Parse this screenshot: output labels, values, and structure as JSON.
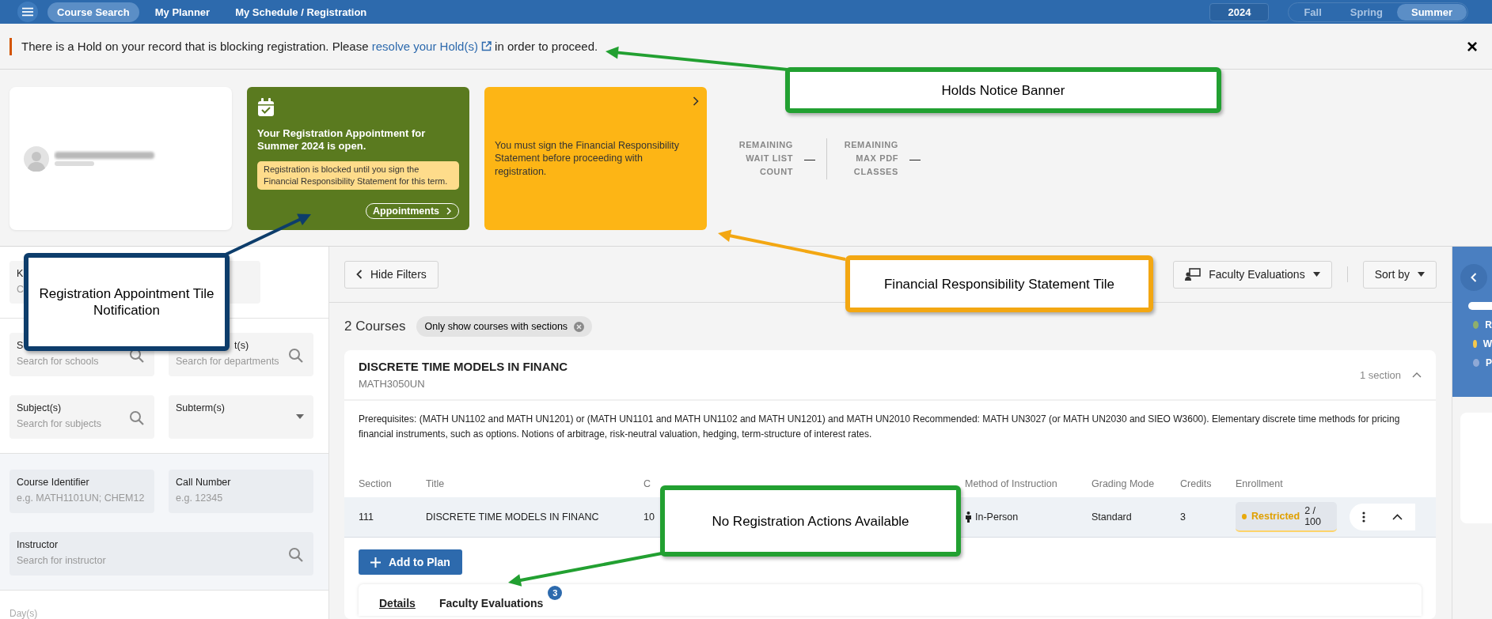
{
  "nav": {
    "items": [
      {
        "label": "Course Search",
        "selected": true
      },
      {
        "label": "My Planner",
        "selected": false
      },
      {
        "label": "My Schedule / Registration",
        "selected": false
      }
    ],
    "year": "2024",
    "terms": [
      {
        "label": "Fall",
        "selected": false
      },
      {
        "label": "Spring",
        "selected": false
      },
      {
        "label": "Summer",
        "selected": true
      }
    ]
  },
  "banner": {
    "before": "There is a Hold on your record that is blocking registration. Please ",
    "link": "resolve your Hold(s)",
    "after": " in order to proceed.",
    "close": "×"
  },
  "tiles": [
    {
      "kind": "appointment",
      "title": "Your Registration Appointment for Summer 2024 is open.",
      "note": "Registration is blocked until you sign the Financial Responsibility Statement for this term.",
      "button": "Appointments"
    },
    {
      "kind": "notice",
      "text": "You must sign the Financial Responsibility Statement before proceeding with registration."
    }
  ],
  "stats": [
    {
      "label": "REMAINING WAIT LIST COUNT",
      "value": "—"
    },
    {
      "label": "REMAINING MAX PDF CLASSES",
      "value": "—"
    }
  ],
  "filters": {
    "keyword": {
      "label": "K",
      "placeholder": "C"
    },
    "rows": [
      [
        {
          "kind": "search",
          "label": "S",
          "placeholder": "Search for schools"
        },
        {
          "kind": "search",
          "label": "t(s)",
          "placeholder": "Search for departments"
        }
      ],
      [
        {
          "kind": "search",
          "label": "Subject(s)",
          "placeholder": "Search for subjects"
        },
        {
          "kind": "select",
          "label": "Subterm(s)"
        }
      ]
    ],
    "advanced": [
      [
        {
          "kind": "text",
          "label": "Course Identifier",
          "placeholder": "e.g. MATH1101UN; CHEM12"
        },
        {
          "kind": "text",
          "label": "Call Number",
          "placeholder": "e.g. 12345"
        }
      ],
      [
        {
          "kind": "search",
          "label": "Instructor",
          "placeholder": "Search for instructor"
        }
      ]
    ],
    "days_label": "Day(s)"
  },
  "toolbar": {
    "hide_filters": "Hide Filters",
    "evaluations": "Faculty Evaluations",
    "sort": "Sort by"
  },
  "results": {
    "count": "2 Courses",
    "chip": "Only show courses with sections"
  },
  "course": {
    "title": "DISCRETE TIME MODELS IN FINANC",
    "code": "MATH3050UN",
    "sections": "1 section",
    "expanded": true,
    "description": "Prerequisites: (MATH UN1102 and MATH UN1201) or (MATH UN1101 and MATH UN1102 and MATH UN1201) and MATH UN2010 Recommended: MATH UN3027 (or MATH UN2030 and SIEO W3600). Elementary discrete time methods for pricing financial instruments, such as options. Notions of arbitrage, risk-neutral valuation, hedging, term-structure of interest rates.",
    "columns": [
      "Section",
      "Title",
      "C",
      "Method of Instruction",
      "Grading Mode",
      "Credits",
      "Enrollment"
    ],
    "row": {
      "cells": [
        "111",
        "DISCRETE TIME MODELS IN FINANC",
        "10",
        "In-Person",
        "Standard",
        "3"
      ],
      "status": "Restricted",
      "count": "2 / 100"
    },
    "add_button": "Add to Plan",
    "tabs": [
      {
        "label": "Details",
        "selected": true
      },
      {
        "label": "Faculty Evaluations",
        "badge": "3",
        "selected": false
      }
    ]
  },
  "legend": [
    {
      "label": "R",
      "color": "#8faf6b"
    },
    {
      "label": "W",
      "color": "#f5c84c"
    },
    {
      "label": "P",
      "color": "#8fa9d6"
    }
  ],
  "callouts": [
    {
      "text": "Holds Notice Banner",
      "color": "#22a031"
    },
    {
      "text": "Registration Appointment Tile Notification",
      "color": "#0d3d6b"
    },
    {
      "text": "Financial Responsibility Statement Tile",
      "color": "#f3a712"
    },
    {
      "text": "No Registration Actions Available",
      "color": "#22a031"
    }
  ]
}
